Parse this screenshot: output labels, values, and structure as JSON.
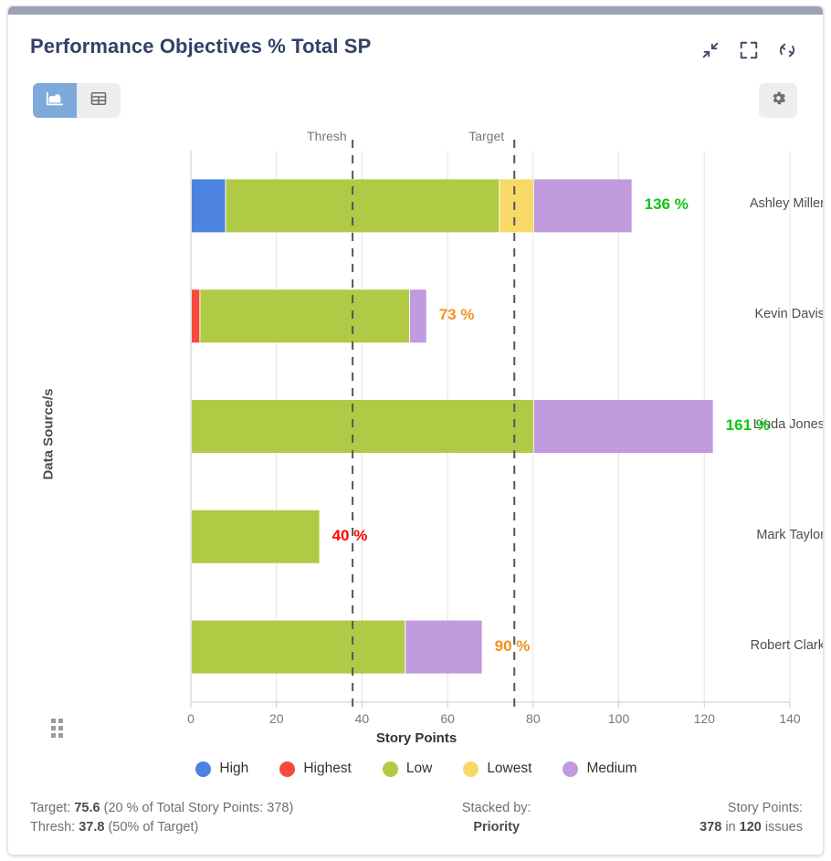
{
  "header": {
    "title": "Performance Objectives % Total SP",
    "icons": [
      {
        "name": "collapse-icon",
        "label": "Collapse"
      },
      {
        "name": "fullscreen-icon",
        "label": "Fullscreen"
      },
      {
        "name": "refresh-icon",
        "label": "Refresh"
      }
    ]
  },
  "toolbar": {
    "chart_view_label": "Chart view",
    "table_view_label": "Table view",
    "settings_label": "Settings",
    "active_view": "chart"
  },
  "chart_data": {
    "type": "bar",
    "orientation": "horizontal",
    "stacked": true,
    "title": "Performance Objectives % Total SP",
    "xlabel": "Story Points",
    "ylabel": "Data Source/s",
    "xlim": [
      0,
      140
    ],
    "xticks": [
      0,
      20,
      40,
      60,
      80,
      100,
      120,
      140
    ],
    "grid": true,
    "legend_position": "bottom",
    "categories": [
      "Ashley Miller",
      "Kevin Davis",
      "Linda Jones",
      "Mark Taylor",
      "Robert Clark"
    ],
    "series": [
      {
        "name": "High",
        "color": "#4d83e0",
        "values": [
          8,
          0,
          0,
          0,
          0
        ]
      },
      {
        "name": "Highest",
        "color": "#f74a3c",
        "values": [
          0,
          2,
          0,
          0,
          0
        ]
      },
      {
        "name": "Low",
        "color": "#b0ca45",
        "values": [
          64,
          49,
          80,
          30,
          50
        ]
      },
      {
        "name": "Lowest",
        "color": "#f7d967",
        "values": [
          8,
          0,
          0,
          0,
          0
        ]
      },
      {
        "name": "Medium",
        "color": "#c29ade",
        "values": [
          23,
          4,
          42,
          0,
          18
        ]
      }
    ],
    "totals": [
      103,
      55,
      122,
      30,
      68
    ],
    "value_labels": [
      {
        "text": "136 %",
        "color": "#11c411"
      },
      {
        "text": "73 %",
        "color": "#f0921e"
      },
      {
        "text": "161 %",
        "color": "#11c411"
      },
      {
        "text": "40 %",
        "color": "#ff0000"
      },
      {
        "text": "90 %",
        "color": "#f0921e"
      }
    ],
    "markers": [
      {
        "name": "Thresh",
        "value": 37.8
      },
      {
        "name": "Target",
        "value": 75.6
      }
    ]
  },
  "footer": {
    "target_prefix": "Target: ",
    "target_value": "75.6",
    "target_suffix": " (20 % of Total Story Points: 378)",
    "thresh_prefix": "Thresh: ",
    "thresh_value": "37.8",
    "thresh_suffix": " (50% of Target)",
    "stacked_by_label": "Stacked by:",
    "stacked_by_value": "Priority",
    "story_points_label": "Story Points:",
    "story_points_value": "378",
    "story_points_mid": " in ",
    "issues_value": "120",
    "issues_suffix": " issues"
  },
  "drag_handle_label": "Drag handle"
}
